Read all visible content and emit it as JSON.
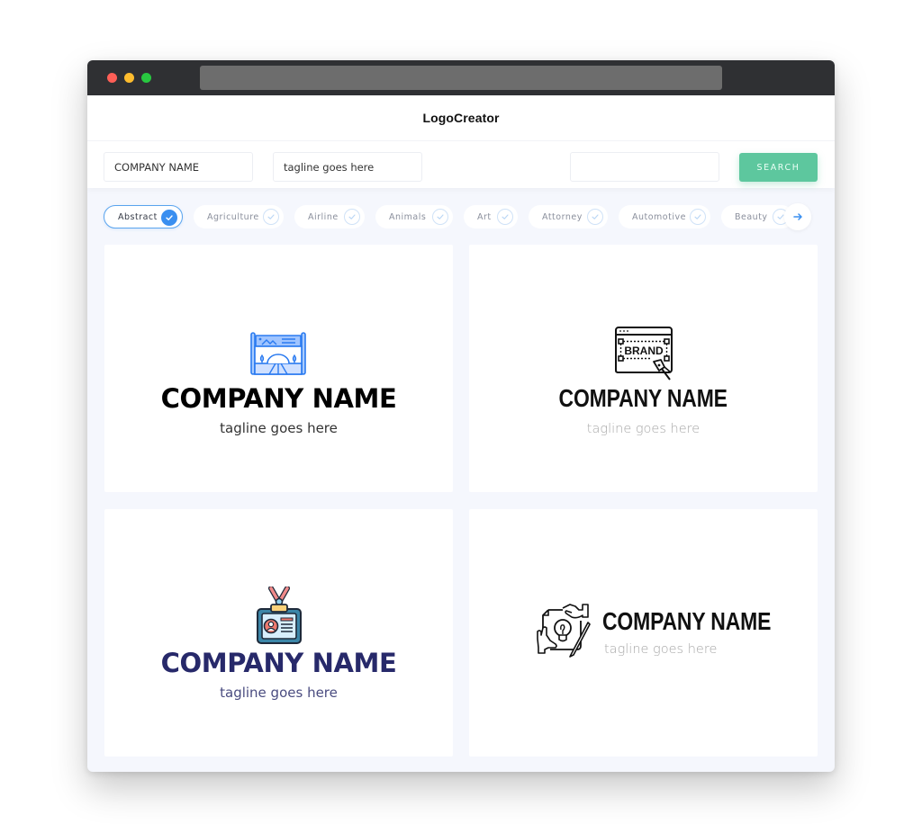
{
  "window": {
    "controls": [
      "close",
      "minimize",
      "maximize"
    ]
  },
  "app": {
    "title": "LogoCreator"
  },
  "toolbar": {
    "company_name_value": "COMPANY NAME",
    "tagline_value": "tagline goes here",
    "extra_value": "",
    "search_label": "SEARCH"
  },
  "categories": {
    "items": [
      {
        "label": "Abstract",
        "selected": true
      },
      {
        "label": "Agriculture",
        "selected": false
      },
      {
        "label": "Airline",
        "selected": false
      },
      {
        "label": "Animals",
        "selected": false
      },
      {
        "label": "Art",
        "selected": false
      },
      {
        "label": "Attorney",
        "selected": false
      },
      {
        "label": "Automotive",
        "selected": false
      },
      {
        "label": "Beauty",
        "selected": false
      }
    ],
    "next_icon": "arrow-right-icon"
  },
  "logos": [
    {
      "icon": "billboard-landscape-icon",
      "company": "COMPANY NAME",
      "tagline": "tagline goes here",
      "name_color": "#000000",
      "tagline_color": "#333333",
      "icon_color": "#2b7bf0"
    },
    {
      "icon": "brand-pen-tool-icon",
      "company": "COMPANY NAME",
      "tagline": "tagline goes here",
      "name_color": "#111111",
      "tagline_color": "#a7a7a7"
    },
    {
      "icon": "id-badge-icon",
      "company": "COMPANY NAME",
      "tagline": "tagline goes here",
      "name_color": "#27296a",
      "tagline_color": "#4a4c80"
    },
    {
      "icon": "idea-collaboration-icon",
      "company": "COMPANY NAME",
      "tagline": "tagline goes here",
      "name_color": "#111111",
      "tagline_color": "#a7a7a7"
    }
  ],
  "colors": {
    "accent": "#3a8ff0",
    "search_button": "#5dc79e",
    "background": "#f5f7fd"
  }
}
